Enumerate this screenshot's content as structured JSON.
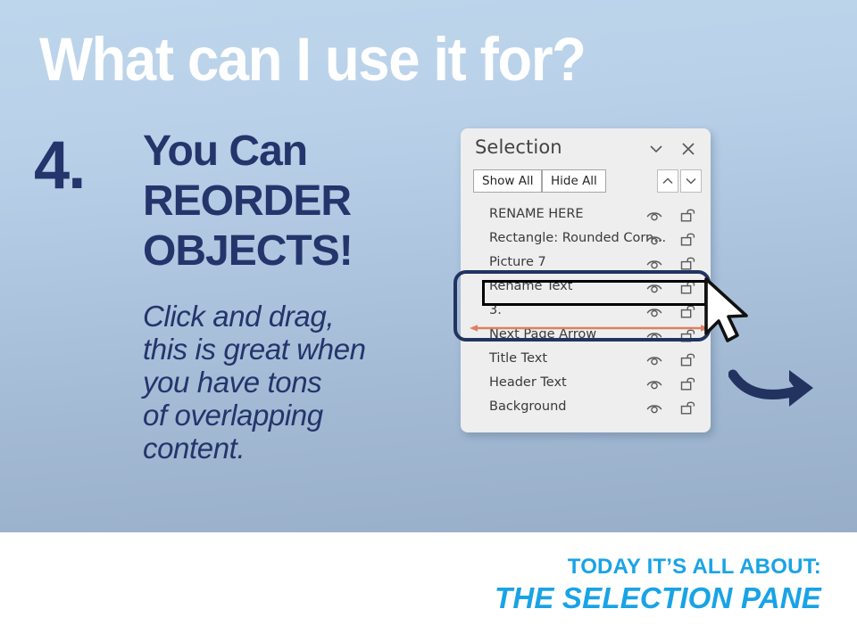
{
  "slide": {
    "title": "What can I use it for?",
    "number": "4.",
    "heading_lines": [
      "You Can",
      "REORDER",
      "OBJECTS!"
    ],
    "body_lines": [
      "Click and drag,",
      "this is great when",
      "you have tons",
      "of overlapping",
      "content."
    ]
  },
  "pane": {
    "title": "Selection",
    "collapse_icon": "chevron-down-icon",
    "close_icon": "close-icon",
    "show_all_label": "Show All",
    "hide_all_label": "Hide All",
    "move_up_icon": "chevron-up-icon",
    "move_down_icon": "chevron-down-icon",
    "items": [
      {
        "label": "RENAME HERE",
        "visibility_icon": "eye-icon",
        "lock_icon": "unlocked-padlock-icon"
      },
      {
        "label": "Rectangle: Rounded Corn...",
        "visibility_icon": "eye-icon",
        "lock_icon": "unlocked-padlock-icon"
      },
      {
        "label": "Picture 7",
        "visibility_icon": "eye-icon",
        "lock_icon": "unlocked-padlock-icon"
      },
      {
        "label": "Rename Text",
        "visibility_icon": "eye-icon",
        "lock_icon": "unlocked-padlock-icon"
      },
      {
        "label": "3.",
        "visibility_icon": "eye-icon",
        "lock_icon": "unlocked-padlock-icon"
      },
      {
        "label": "Next Page Arrow",
        "visibility_icon": "eye-icon",
        "lock_icon": "unlocked-padlock-icon"
      },
      {
        "label": "Title Text",
        "visibility_icon": "eye-icon",
        "lock_icon": "unlocked-padlock-icon"
      },
      {
        "label": "Header Text",
        "visibility_icon": "eye-icon",
        "lock_icon": "unlocked-padlock-icon"
      },
      {
        "label": "Background",
        "visibility_icon": "eye-icon",
        "lock_icon": "unlocked-padlock-icon"
      }
    ]
  },
  "annotations": {
    "highlight_box_icon": "rounded-highlight-box",
    "selected_item_box_icon": "selected-item-box",
    "drag_arrow_icon": "double-headed-drag-arrow",
    "cursor_icon": "mouse-pointer-icon",
    "next_arrow_icon": "curved-right-arrow-icon"
  },
  "footer": {
    "line1": "TODAY IT’S ALL ABOUT:",
    "line2": "THE SELECTION PANE"
  },
  "colors": {
    "navy": "#23356b",
    "accent_blue": "#19a3e6",
    "drag_arrow": "#de7f62",
    "bg_top": "#bed6ec",
    "bg_bottom": "#97aec9",
    "pane_bg": "#eeeeee"
  }
}
